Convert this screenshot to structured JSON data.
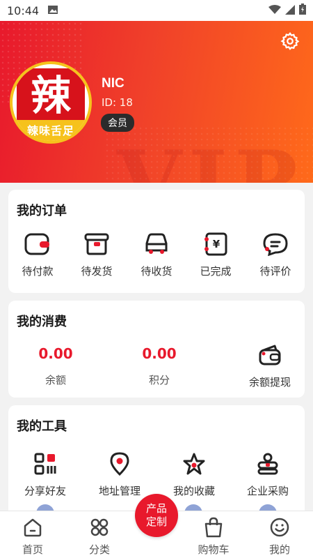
{
  "status": {
    "time": "10:44"
  },
  "profile": {
    "avatar_char": "辣",
    "avatar_slogan": "辣味舌足",
    "name": "NIC",
    "id_text": "ID: 18",
    "badge": "会员"
  },
  "orders": {
    "title": "我的订单",
    "items": [
      {
        "label": "待付款",
        "icon": "wallet-icon"
      },
      {
        "label": "待发货",
        "icon": "box-icon"
      },
      {
        "label": "待收货",
        "icon": "truck-icon"
      },
      {
        "label": "已完成",
        "icon": "receipt-icon"
      },
      {
        "label": "待评价",
        "icon": "chat-icon"
      }
    ]
  },
  "consumption": {
    "title": "我的消费",
    "balance_value": "0.00",
    "balance_label": "余额",
    "points_value": "0.00",
    "points_label": "积分",
    "withdraw_label": "余额提现"
  },
  "tools": {
    "title": "我的工具",
    "items": [
      {
        "label": "分享好友",
        "icon": "qr-share-icon"
      },
      {
        "label": "地址管理",
        "icon": "location-pin-icon"
      },
      {
        "label": "我的收藏",
        "icon": "star-icon"
      },
      {
        "label": "企业采购",
        "icon": "enterprise-icon"
      }
    ]
  },
  "tabbar": {
    "home": "首页",
    "category": "分类",
    "fab_line1": "产品",
    "fab_line2": "定制",
    "cart": "购物车",
    "mine": "我的"
  },
  "colors": {
    "accent": "#e8192c",
    "header_gradient_end": "#ff6a1a",
    "avatar_ring": "#f6c21c"
  }
}
